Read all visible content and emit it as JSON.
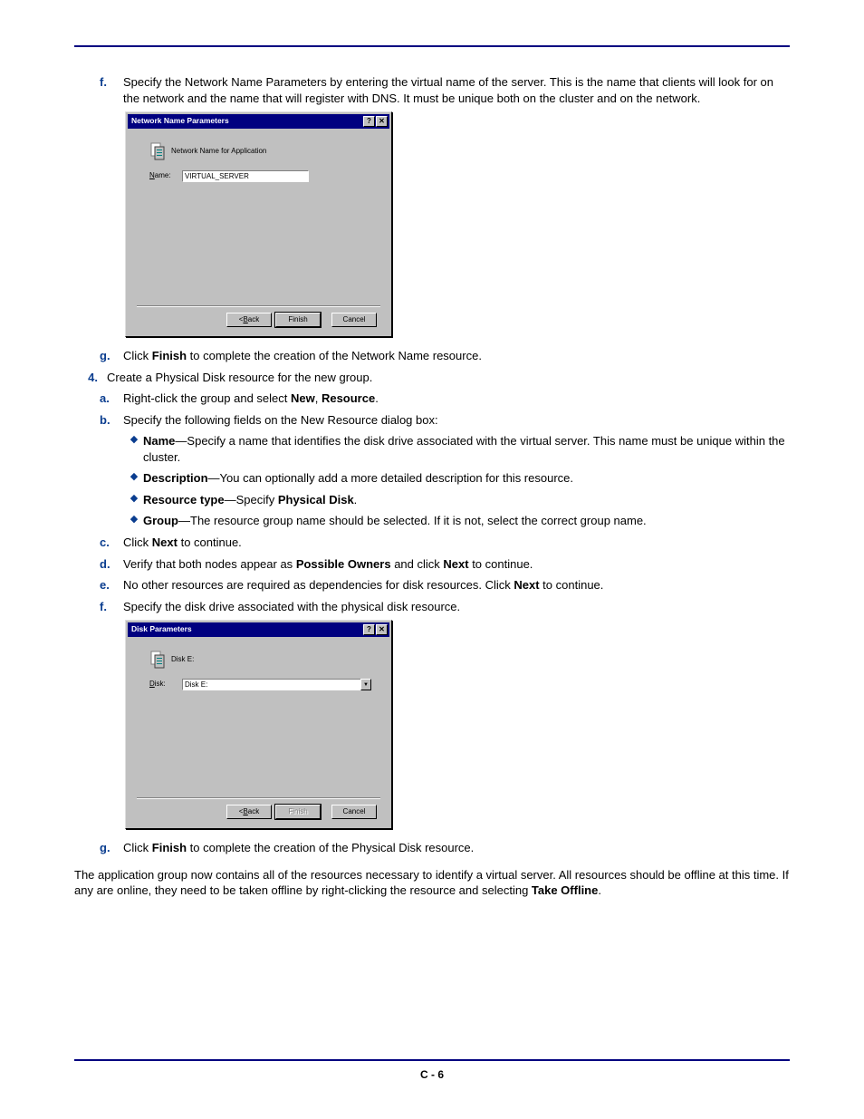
{
  "step_f": {
    "marker": "f.",
    "text": "Specify the Network Name Parameters by entering the virtual name of the server. This is the name that clients will look for on the network and the name that will register with DNS. It must be unique both on the cluster and on the network."
  },
  "dialog1": {
    "title": "Network Name Parameters",
    "help": "?",
    "close": "✕",
    "subtitle": "Network Name for Application",
    "name_label_u": "N",
    "name_label_rest": "ame:",
    "name_value": "VIRTUAL_SERVER",
    "back_u": "B",
    "back_rest": "ack",
    "back_pre": "< ",
    "finish": "Finish",
    "cancel": "Cancel"
  },
  "step_g1": {
    "marker": "g.",
    "pre": "Click ",
    "b": "Finish",
    "post": " to complete the creation of the Network Name resource."
  },
  "step_4": {
    "marker": "4.",
    "text": "Create a Physical Disk resource for the new group."
  },
  "step_a": {
    "marker": "a.",
    "pre": "Right-click the group and select ",
    "b1": "New",
    "sep": ", ",
    "b2": "Resource",
    "post": "."
  },
  "step_b": {
    "marker": "b.",
    "text": "Specify the following fields on the New Resource dialog box:"
  },
  "bullet_name": {
    "b": "Name",
    "rest": "—Specify a name that identifies the disk drive associated with the virtual server. This name must be unique within the cluster."
  },
  "bullet_desc": {
    "b": "Description",
    "rest": "—You can optionally add a more detailed description for this resource."
  },
  "bullet_type": {
    "b": "Resource type",
    "mid": "—Specify ",
    "b2": "Physical Disk",
    "post": "."
  },
  "bullet_group": {
    "b": "Group",
    "rest": "—The resource group name should be selected. If it is not, select the correct group name."
  },
  "step_c": {
    "marker": "c.",
    "pre": "Click ",
    "b": "Next",
    "post": " to continue."
  },
  "step_d": {
    "marker": "d.",
    "pre": "Verify that both nodes appear as ",
    "b1": "Possible Owners",
    "mid": " and click ",
    "b2": "Next",
    "post": " to continue."
  },
  "step_e": {
    "marker": "e.",
    "pre": "No other resources are required as dependencies for disk resources. Click ",
    "b": "Next",
    "post": " to continue."
  },
  "step_f2": {
    "marker": "f.",
    "text": "Specify the disk drive associated with the physical disk resource."
  },
  "dialog2": {
    "title": "Disk Parameters",
    "help": "?",
    "close": "✕",
    "subtitle": "Disk E:",
    "disk_label_u": "D",
    "disk_label_rest": "isk:",
    "disk_value": "Disk E:",
    "back_u": "B",
    "back_rest": "ack",
    "back_pre": "< ",
    "finish": "Finish",
    "cancel": "Cancel"
  },
  "step_g2": {
    "marker": "g.",
    "pre": "Click ",
    "b": "Finish",
    "post": " to complete the creation of the Physical Disk resource."
  },
  "closing": {
    "pre": "The application group now contains all of the resources necessary to identify a virtual server. All resources should be offline at this time. If any are online, they need to be taken offline by right-clicking the resource and selecting ",
    "b": "Take Offline",
    "post": "."
  },
  "page_footer": "C - 6"
}
